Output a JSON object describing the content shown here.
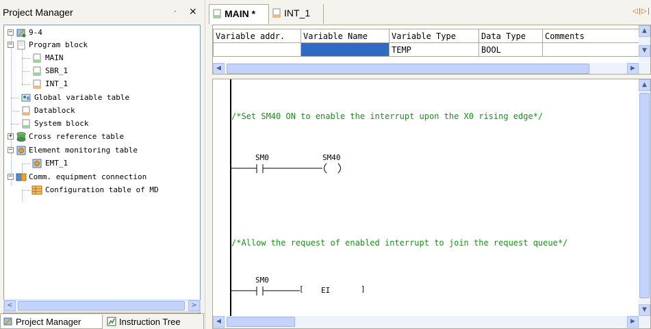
{
  "project_manager": {
    "title": "Project Manager",
    "pin_glyph": "ॱ",
    "close_glyph": "×",
    "tree": [
      {
        "label": "9-4",
        "icon": "project-icon",
        "expander": "−"
      },
      {
        "label": "Program block",
        "icon": "folder-icon",
        "expander": "−"
      },
      {
        "label": "MAIN",
        "icon": "program-page-icon"
      },
      {
        "label": "SBR_1",
        "icon": "program-page-icon"
      },
      {
        "label": "INT_1",
        "icon": "program-page-icon"
      },
      {
        "label": "Global variable table",
        "icon": "variable-table-icon"
      },
      {
        "label": "Datablock",
        "icon": "page-icon"
      },
      {
        "label": "System block",
        "icon": "page-icon"
      },
      {
        "label": "Cross reference table",
        "icon": "cross-reference-icon",
        "expander": "+"
      },
      {
        "label": "Element monitoring table",
        "icon": "monitor-icon",
        "expander": "−"
      },
      {
        "label": "EMT_1",
        "icon": "monitor-icon"
      },
      {
        "label": "Comm. equipment connection",
        "icon": "comm-icon",
        "expander": "−"
      },
      {
        "label": "Configuration table of MD",
        "icon": "table-icon"
      }
    ],
    "scroll_left": "<",
    "scroll_right": ">",
    "bottom_tabs": [
      {
        "label": "Project Manager",
        "icon": "project-manager-icon"
      },
      {
        "label": "Instruction Tree",
        "icon": "instruction-tree-icon"
      }
    ]
  },
  "editor": {
    "tabs": [
      {
        "label": "MAIN *",
        "icon": "program-page-icon",
        "active": true
      },
      {
        "label": "INT_1",
        "icon": "program-page-icon",
        "active": false
      }
    ],
    "tab_nav": "◁|▷|",
    "variable_table": {
      "columns": [
        "Variable addr.",
        "Variable Name",
        "Variable Type",
        "Data Type",
        "Comments"
      ],
      "rows": [
        [
          "",
          "",
          "TEMP",
          "BOOL",
          ""
        ]
      ]
    },
    "ladder": {
      "networks": [
        {
          "comment": "/*Set SM40 ON to enable the interrupt upon the X0 rising edge*/",
          "contact": "SM0",
          "output_coil": "SM40"
        },
        {
          "comment": "/*Allow the request of enabled interrupt to join the request queue*/",
          "contact": "SM0",
          "instruction_open": "[",
          "instruction": "EI",
          "instruction_close": "]"
        }
      ]
    }
  },
  "colors": {
    "comment_green": "#1a8f1a",
    "selection_blue": "#316ac5",
    "panel_bg": "#f4f3ee",
    "scrollbar": "#c9d8fc"
  }
}
